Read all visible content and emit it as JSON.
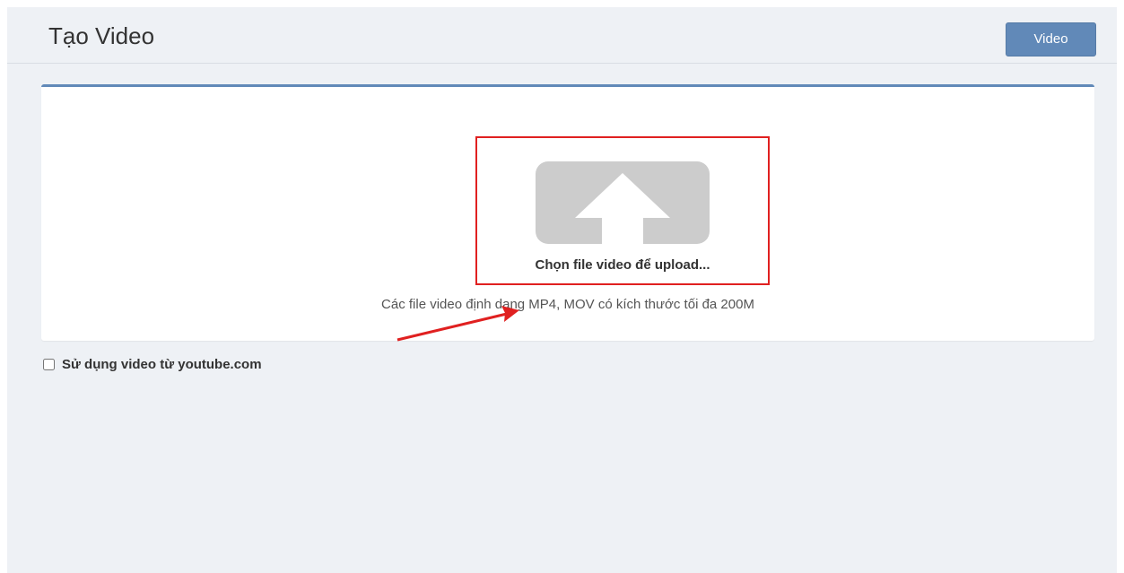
{
  "header": {
    "title": "Tạo Video",
    "video_button_label": "Video"
  },
  "upload": {
    "icon": "upload-arrow-icon",
    "label": "Chọn file video để upload...",
    "hint": "Các file video định dạng MP4, MOV có kích thước tối đa 200M"
  },
  "youtube_option": {
    "label": "Sử dụng video từ youtube.com",
    "checked": false
  },
  "colors": {
    "accent": "#6189b8",
    "highlight": "#e02020",
    "icon_gray": "#cccccc",
    "background": "#eef1f5"
  }
}
